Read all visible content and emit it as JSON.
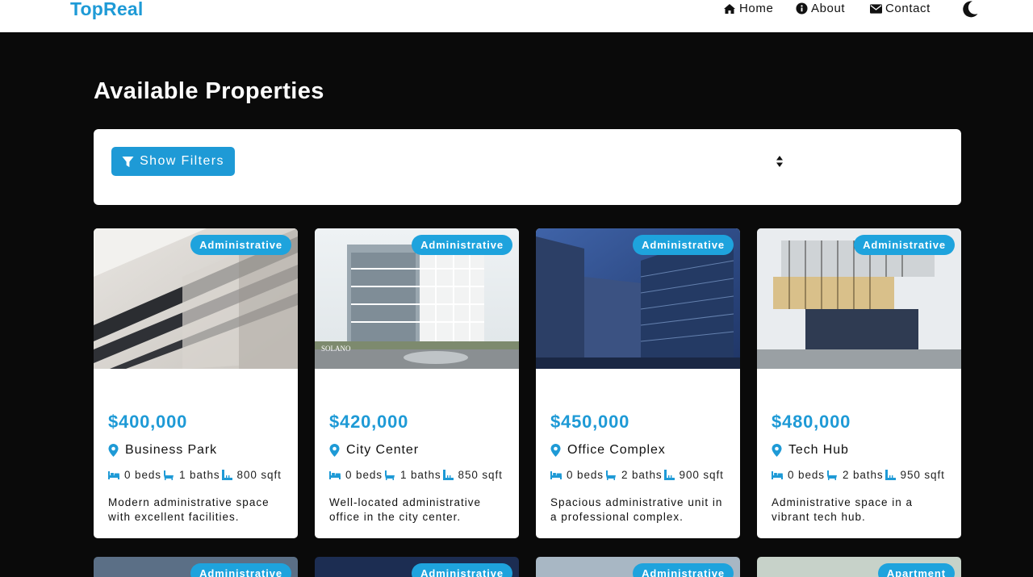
{
  "nav": {
    "brand": "TopReal",
    "links": [
      {
        "label": "Home",
        "icon": "home-icon"
      },
      {
        "label": "About",
        "icon": "info-icon"
      },
      {
        "label": "Contact",
        "icon": "envelope-icon"
      }
    ],
    "theme_toggle_icon": "moon-icon"
  },
  "page": {
    "title": "Available Properties"
  },
  "filters": {
    "button_label": "Show Filters",
    "sort_icon": "sort-icon"
  },
  "colors": {
    "accent": "#1e9ad6",
    "badge": "#1ea3dd",
    "background": "#0a0a0a"
  },
  "properties": [
    {
      "badge": "Administrative",
      "price": "$400,000",
      "location": "Business Park",
      "beds": "0 beds",
      "baths": "1 baths",
      "area": "800 sqft",
      "description": "Modern administrative space with excellent facilities."
    },
    {
      "badge": "Administrative",
      "price": "$420,000",
      "location": "City Center",
      "beds": "0 beds",
      "baths": "1 baths",
      "area": "850 sqft",
      "description": "Well-located administrative office in the city center."
    },
    {
      "badge": "Administrative",
      "price": "$450,000",
      "location": "Office Complex",
      "beds": "0 beds",
      "baths": "2 baths",
      "area": "900 sqft",
      "description": "Spacious administrative unit in a professional complex."
    },
    {
      "badge": "Administrative",
      "price": "$480,000",
      "location": "Tech Hub",
      "beds": "0 beds",
      "baths": "2 baths",
      "area": "950 sqft",
      "description": "Administrative space in a vibrant tech hub."
    }
  ],
  "next_row_badges": [
    "Administrative",
    "Administrative",
    "Administrative",
    "Apartment"
  ]
}
